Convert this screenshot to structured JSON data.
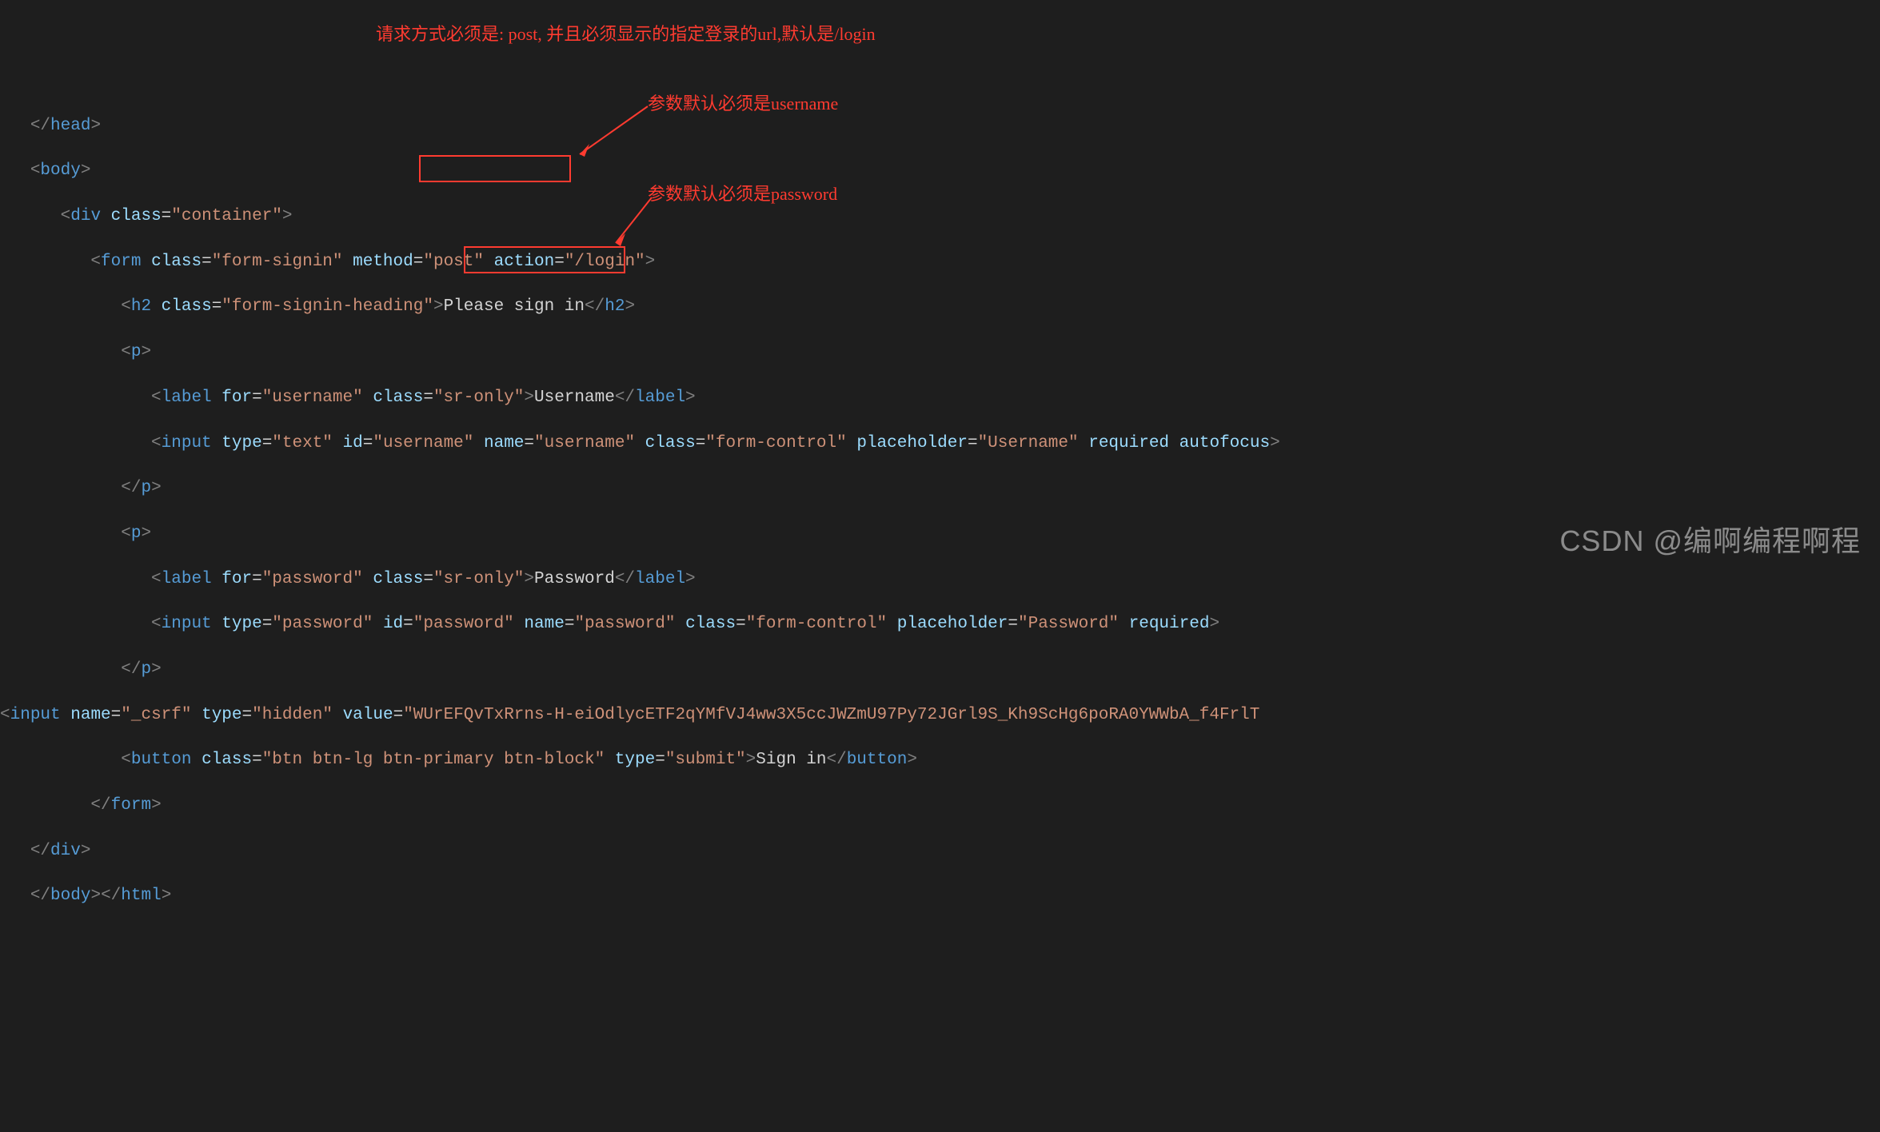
{
  "annotations": {
    "top": "请求方式必须是: post, 并且必须显示的指定登录的url,默认是/login",
    "mid": "参数默认必须是username",
    "low": "参数默认必须是password"
  },
  "watermark": "CSDN @编啊编程啊程",
  "code": {
    "l1_a": "</",
    "l1_b": "head",
    "l1_c": ">",
    "l2_a": "<",
    "l2_b": "body",
    "l2_c": ">",
    "l3_a": "<",
    "l3_b": "div",
    "l3_c": " ",
    "l3_d": "class",
    "l3_e": "=",
    "l3_f": "\"container\"",
    "l3_g": ">",
    "l4_a": "<",
    "l4_b": "form",
    "l4_sp": " ",
    "l4_c": "class",
    "l4_d": "=",
    "l4_e": "\"form-signin\"",
    "l4_sp2": " ",
    "l4_f": "method",
    "l4_g": "=",
    "l4_h": "\"post\"",
    "l4_sp3": " ",
    "l4_i": "action",
    "l4_j": "=",
    "l4_k": "\"/login\"",
    "l4_l": ">",
    "l5_a": "<",
    "l5_b": "h2",
    "l5_sp": " ",
    "l5_c": "class",
    "l5_d": "=",
    "l5_e": "\"form-signin-heading\"",
    "l5_f": ">",
    "l5_g": "Please sign in",
    "l5_h": "</",
    "l5_i": "h2",
    "l5_j": ">",
    "l6_a": "<",
    "l6_b": "p",
    "l6_c": ">",
    "l7_a": "<",
    "l7_b": "label",
    "l7_sp": " ",
    "l7_c": "for",
    "l7_d": "=",
    "l7_e": "\"username\"",
    "l7_sp2": " ",
    "l7_f": "class",
    "l7_g": "=",
    "l7_h": "\"sr-only\"",
    "l7_i": ">",
    "l7_j": "Username",
    "l7_k": "</",
    "l7_l": "label",
    "l7_m": ">",
    "l8_a": "<",
    "l8_b": "input",
    "l8_sp": " ",
    "l8_c": "type",
    "l8_d": "=",
    "l8_e": "\"text\"",
    "l8_sp2": " ",
    "l8_f": "id",
    "l8_g": "=",
    "l8_h": "\"username\"",
    "l8_sp3": " ",
    "l8_i": "name",
    "l8_j": "=",
    "l8_k": "\"username\"",
    "l8_sp4": " ",
    "l8_l": "class",
    "l8_m": "=",
    "l8_n": "\"form-control\"",
    "l8_sp5": " ",
    "l8_o": "placeholder",
    "l8_p": "=",
    "l8_q": "\"Username\"",
    "l8_sp6": " ",
    "l8_r": "required",
    "l8_sp7": " ",
    "l8_s": "autofocus",
    "l8_t": ">",
    "l9_a": "</",
    "l9_b": "p",
    "l9_c": ">",
    "l10_a": "<",
    "l10_b": "p",
    "l10_c": ">",
    "l11_a": "<",
    "l11_b": "label",
    "l11_sp": " ",
    "l11_c": "for",
    "l11_d": "=",
    "l11_e": "\"password\"",
    "l11_sp2": " ",
    "l11_f": "class",
    "l11_g": "=",
    "l11_h": "\"sr-only\"",
    "l11_i": ">",
    "l11_j": "Password",
    "l11_k": "</",
    "l11_l": "label",
    "l11_m": ">",
    "l12_a": "<",
    "l12_b": "input",
    "l12_sp": " ",
    "l12_c": "type",
    "l12_d": "=",
    "l12_e": "\"password\"",
    "l12_sp2": " ",
    "l12_f": "id",
    "l12_g": "=",
    "l12_h": "\"password\"",
    "l12_sp3": " ",
    "l12_i": "name",
    "l12_j": "=",
    "l12_k": "\"password\"",
    "l12_sp4": " ",
    "l12_l": "class",
    "l12_m": "=",
    "l12_n": "\"form-control\"",
    "l12_sp5": " ",
    "l12_o": "placeholder",
    "l12_p": "=",
    "l12_q": "\"Password\"",
    "l12_sp6": " ",
    "l12_r": "required",
    "l12_s": ">",
    "l13_a": "</",
    "l13_b": "p",
    "l13_c": ">",
    "l14_a": "<",
    "l14_b": "input",
    "l14_sp": " ",
    "l14_c": "name",
    "l14_d": "=",
    "l14_e": "\"_csrf\"",
    "l14_sp2": " ",
    "l14_f": "type",
    "l14_g": "=",
    "l14_h": "\"hidden\"",
    "l14_sp3": " ",
    "l14_i": "value",
    "l14_j": "=",
    "l14_k": "\"WUrEFQvTxRrns-H-eiOdlycETF2qYMfVJ4ww3X5ccJWZmU97Py72JGrl9S_Kh9ScHg6poRA0YWWbA_f4FrlT",
    "l15_a": "<",
    "l15_b": "button",
    "l15_sp": " ",
    "l15_c": "class",
    "l15_d": "=",
    "l15_e": "\"btn btn-lg btn-primary btn-block\"",
    "l15_sp2": " ",
    "l15_f": "type",
    "l15_g": "=",
    "l15_h": "\"submit\"",
    "l15_i": ">",
    "l15_j": "Sign in",
    "l15_k": "</",
    "l15_l": "button",
    "l15_m": ">",
    "l16_a": "</",
    "l16_b": "form",
    "l16_c": ">",
    "l17_a": "</",
    "l17_b": "div",
    "l17_c": ">",
    "l18_a": "</",
    "l18_b": "body",
    "l18_c": ">",
    "l18_d": "</",
    "l18_e": "html",
    "l18_f": ">"
  }
}
